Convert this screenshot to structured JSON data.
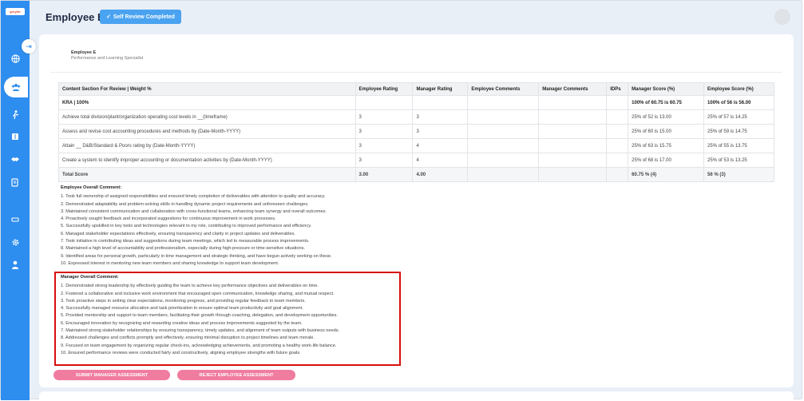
{
  "brand": {
    "logo_text": "greythr"
  },
  "header": {
    "title": "Employee E",
    "status_badge": "Self Review Completed",
    "status_icon": "✓"
  },
  "employee": {
    "name": "Employee E",
    "role": "Performance and Learning Specialist"
  },
  "sidebar": {
    "icons": [
      "globe-icon",
      "team-icon",
      "person-run-icon",
      "book-icon",
      "handshake-icon",
      "document-edit-icon",
      "tray-icon",
      "gear-icon",
      "user-icon"
    ]
  },
  "table": {
    "headers": [
      "Content Section For Review | Weight %",
      "Employee Rating",
      "Manager Rating",
      "Employee Comments",
      "Manager Comments",
      "IDPs",
      "Manager Score (%)",
      "Employee Score (%)"
    ],
    "kra_row": [
      "KRA | 100%",
      "",
      "",
      "",
      "",
      "",
      "100% of 60.75 is 60.75",
      "100% of 56 is 56.00"
    ],
    "rows": [
      [
        "Achieve total division/plant/organization operating cost levels in __(timeframe)",
        "3",
        "3",
        "",
        "",
        "",
        "25% of 52 is 13.00",
        "25% of 57 is 14.25"
      ],
      [
        "Assess and revise cost accounting procedures and methods by (Date-Month-YYYY)",
        "3",
        "3",
        "",
        "",
        "",
        "25% of 60 is 15.00",
        "25% of 59 is 14.75"
      ],
      [
        "Attain __ D&B/Standard & Poors rating by (Date-Month-YYYY)",
        "3",
        "4",
        "",
        "",
        "",
        "25% of 63 is 15.75",
        "25% of 55 is 13.75"
      ],
      [
        "Create a system to identify improper accounting or documentation activities by (Date-Month-YYYY)",
        "3",
        "4",
        "",
        "",
        "",
        "25% of 68 is 17.00",
        "25% of 53 is 13.25"
      ]
    ],
    "total_row": [
      "Total Score",
      "3.00",
      "4.00",
      "",
      "",
      "",
      "60.75 % (4)",
      "56 % (3)"
    ]
  },
  "employee_comment": {
    "heading": "Employee Overall Comment:",
    "lines": [
      "1. Took full ownership of assigned responsibilities and ensured timely completion of deliverables with attention to quality and accuracy.",
      "2. Demonstrated adaptability and problem-solving skills in handling dynamic project requirements and unforeseen challenges.",
      "3. Maintained consistent communication and collaboration with cross-functional teams, enhancing team synergy and overall outcomes.",
      "4. Proactively sought feedback and incorporated suggestions for continuous improvement in work processes.",
      "5. Successfully upskilled in key tools and technologies relevant to my role, contributing to improved performance and efficiency.",
      "6. Managed stakeholder expectations effectively, ensuring transparency and clarity in project updates and deliverables.",
      "7. Took initiative in contributing ideas and suggestions during team meetings, which led to measurable process improvements.",
      "8. Maintained a high level of accountability and professionalism, especially during high-pressure or time-sensitive situations.",
      "9. Identified areas for personal growth, particularly in time management and strategic thinking, and have begun actively working on these.",
      "10. Expressed interest in mentoring new team members and sharing knowledge to support team development."
    ]
  },
  "manager_comment": {
    "heading": "Manager Overall Comment:",
    "lines": [
      "1. Demonstrated strong leadership by effectively guiding the team to achieve key performance objectives and deliverables on time.",
      "2. Fostered a collaborative and inclusive work environment that encouraged open communication, knowledge sharing, and mutual respect.",
      "3. Took proactive steps in setting clear expectations, monitoring progress, and providing regular feedback to team members.",
      "4. Successfully managed resource allocation and task prioritization to ensure optimal team productivity and goal alignment.",
      "5. Provided mentorship and support to team members, facilitating their growth through coaching, delegation, and development opportunities.",
      "6. Encouraged innovation by recognizing and rewarding creative ideas and process improvements suggested by the team.",
      "7. Maintained strong stakeholder relationships by ensuring transparency, timely updates, and alignment of team outputs with business needs.",
      "8. Addressed challenges and conflicts promptly and effectively, ensuring minimal disruption to project timelines and team morale.",
      "9. Focused on team engagement by organizing regular check-ins, acknowledging achievements, and promoting a healthy work-life balance.",
      "10. Ensured performance reviews were conducted fairly and constructively, aligning employee strengths with future goals."
    ]
  },
  "actions": {
    "submit": "SUBMIT MANAGER ASSESSMENT",
    "reject": "REJECT EMPLOYEE ASSESSMENT"
  },
  "colors": {
    "sidebar": "#2e8ef0",
    "badge": "#4aa3f0",
    "button": "#f07ca0",
    "highlight": "#d80f0f"
  }
}
